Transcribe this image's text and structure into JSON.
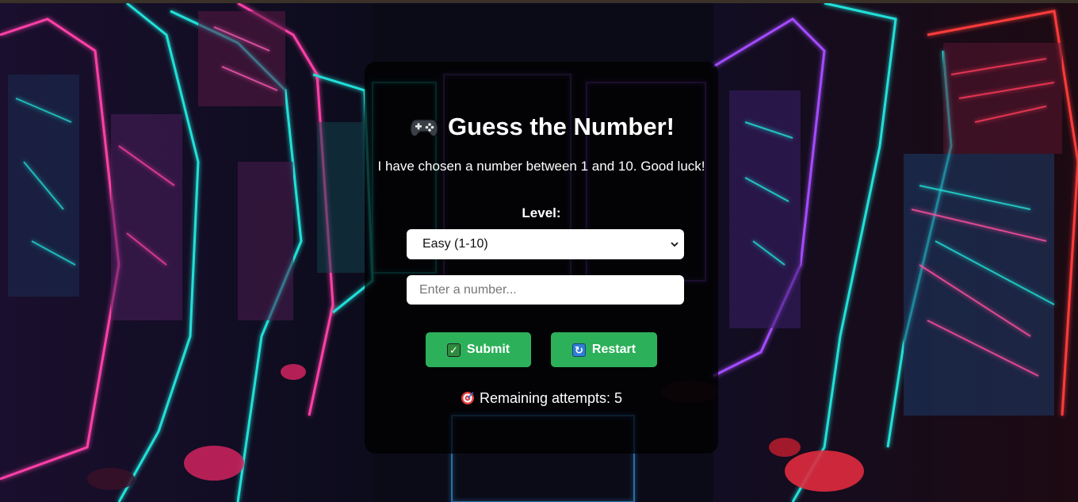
{
  "game": {
    "title": "Guess the Number!",
    "title_icon": "gamepad-icon",
    "intro": "I have chosen a number between 1 and 10. Good luck!",
    "level_label": "Level:",
    "level_selected": "Easy (1-10)",
    "input_placeholder": "Enter a number...",
    "input_value": "",
    "submit_label": "Submit",
    "submit_icon": "check-mark-icon",
    "restart_label": "Restart",
    "restart_icon": "refresh-icon",
    "attempts_text": "Remaining attempts: 5",
    "attempts_icon": "target-icon"
  },
  "colors": {
    "button": "#2db05a",
    "panel": "rgba(0,0,0,0.72)",
    "neon_cyan": "#22e0d8",
    "neon_pink": "#ff2f8f",
    "neon_purple": "#9a3cff"
  }
}
